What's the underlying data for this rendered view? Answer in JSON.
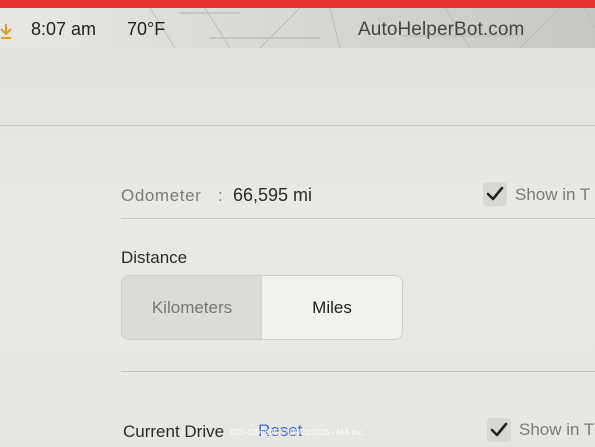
{
  "status_bar": {
    "time": "8:07 am",
    "temperature": "70°F",
    "download_icon": "download-arrow-icon"
  },
  "watermark": "AutoHelperBot.com",
  "odometer": {
    "label": "Odometer",
    "separator": ":",
    "value": "66,595 mi",
    "show_label": "Show in T",
    "checked": true
  },
  "distance": {
    "title": "Distance",
    "options": [
      "Kilometers",
      "Miles"
    ],
    "selected": "Miles"
  },
  "current_drive": {
    "label": "Current Drive",
    "reset_label": "Reset",
    "show_label": "Show in T",
    "checked": true
  },
  "footer": "000-42968452 - 08/20/2025 - IAA Inc.",
  "colors": {
    "accent_red": "#e2312f",
    "link_blue": "#3a6fd8",
    "background": "#e6e4df"
  }
}
